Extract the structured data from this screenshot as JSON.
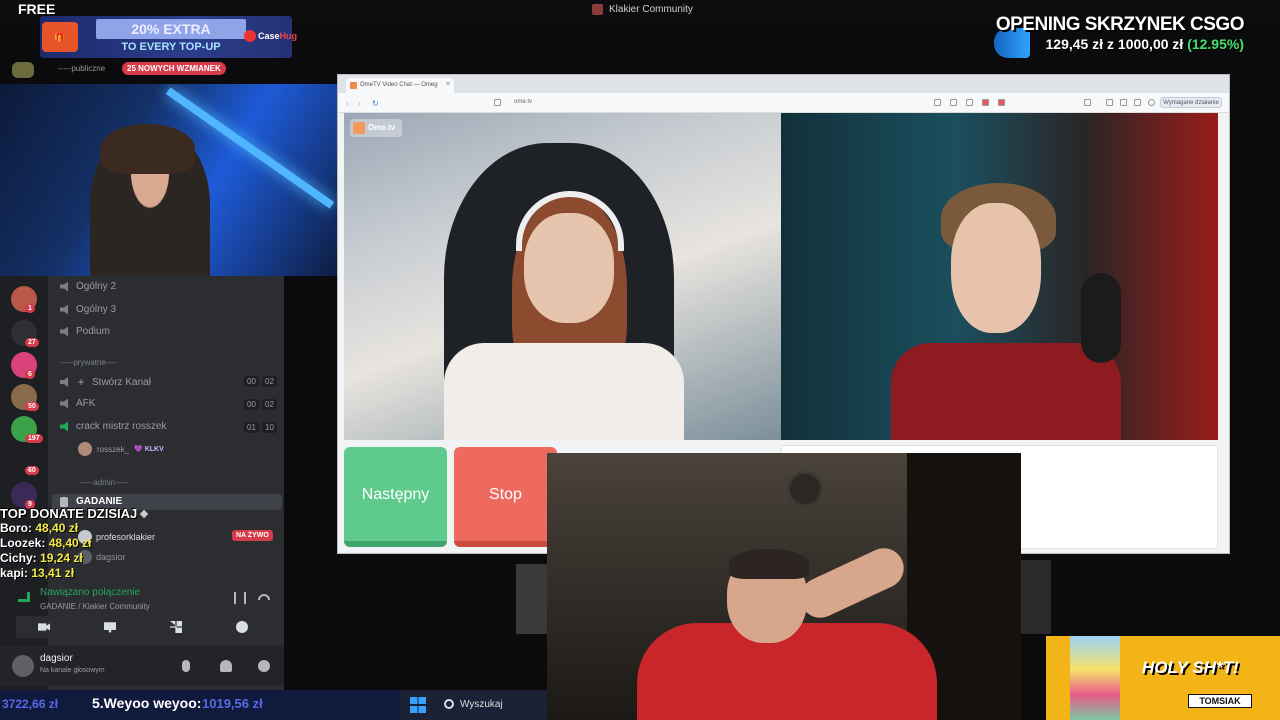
{
  "window": {
    "title": "Klakier Community"
  },
  "overlay": {
    "free_label": "FREE",
    "promo_extra": "20% EXTRA",
    "promo_every": "TO EVERY TOP-UP",
    "promo_brand_a": "Case",
    "promo_brand_b": "Hug",
    "csgo_title": "OPENING SKRZYNEK CSGO",
    "csgo_current": "129,45 zł",
    "csgo_sep": "z",
    "csgo_goal": "1000,00 zł",
    "csgo_pct": "(12.95%)"
  },
  "mentions": {
    "label": "-----publiczne",
    "badge": "25 NOWYCH WZMIANEK"
  },
  "discord": {
    "guilds": [
      {
        "color": "#b8584a",
        "badge": "1"
      },
      {
        "color": "#2d2f35",
        "badge": "27"
      },
      {
        "color": "#d9427a",
        "badge": "6"
      },
      {
        "color": "#8a6a4c",
        "badge": "50"
      },
      {
        "color": "#3aa34a",
        "badge": "197"
      },
      {
        "color": "#1e1f22",
        "badge": "60"
      },
      {
        "color": "#3b2a58",
        "badge": "9"
      }
    ],
    "channels_top": [
      "Ogólny 2",
      "Ogólny 3",
      "Podium"
    ],
    "cat_private": "-----prywatne----",
    "create_channel": "Stwórz Kanał",
    "create_counts": [
      "00",
      "02"
    ],
    "afk": "AFK",
    "afk_counts": [
      "00",
      "02"
    ],
    "crack": "crack mistrz rosszek",
    "crack_counts": [
      "01",
      "10"
    ],
    "member_name": "rosszek_",
    "member_tag": "KLKV",
    "cat_admin": "-----admin-----",
    "voice_channel": "GADANIE",
    "voice_users": [
      "profesorklakier",
      "dagsior"
    ],
    "live_badge": "NA ŻYWO",
    "connection_title": "Nawiązano połączenie",
    "connection_sub": "GADANIE / Klakier Community",
    "user_name": "dagsior",
    "user_status": "Na kanale głosowym"
  },
  "donate": {
    "title": "TOP DONATE DZISIAJ",
    "rows": [
      {
        "name": "Boro:",
        "amount": "48,40 zł"
      },
      {
        "name": "Loozek:",
        "amount": "48,40 zł"
      },
      {
        "name": "Cichy:",
        "amount": "19,24 zł"
      },
      {
        "name": "kapi:",
        "amount": "13,41 zł"
      }
    ]
  },
  "browser": {
    "tab_title": "OmeTV Video Chat — Omeg",
    "url": "ome.tv",
    "wymagane": "Wymagane działanie",
    "ome_logo": "Ome.tv",
    "btn_next": "Następny",
    "btn_stop": "Stop"
  },
  "ticker": {
    "prev_amount": "3722,66 zł",
    "entry": "5.Weyoo weyoo:",
    "entry_amount": "1019,56 zł"
  },
  "taskbar": {
    "search": "Wyszukaj"
  },
  "ad": {
    "title": "HOLY SH*T!",
    "name": "TOMSIAK"
  }
}
